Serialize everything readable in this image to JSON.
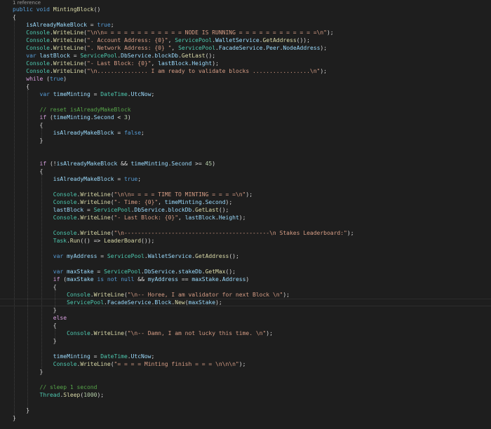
{
  "editor": {
    "codelens_text": "1 reference",
    "lines": [
      [
        [
          "kw",
          "public"
        ],
        [
          "pn",
          " "
        ],
        [
          "kw",
          "void"
        ],
        [
          "pn",
          " "
        ],
        [
          "fn",
          "MintingBlock"
        ],
        [
          "pn",
          "()"
        ]
      ],
      [
        [
          "pn",
          "{"
        ]
      ],
      [
        [
          "pn",
          "    "
        ],
        [
          "var",
          "isAlreadyMakeBlock"
        ],
        [
          "pn",
          " = "
        ],
        [
          "kw",
          "true"
        ],
        [
          "pn",
          ";"
        ]
      ],
      [
        [
          "pn",
          "    "
        ],
        [
          "ty",
          "Console"
        ],
        [
          "pn",
          "."
        ],
        [
          "fn",
          "WriteLine"
        ],
        [
          "pn",
          "("
        ],
        [
          "str",
          "\"\\n\\n= = = = = = = = = = = = NODE IS RUNNING = = = = = = = = = = = =\\n\""
        ],
        [
          "pn",
          ");"
        ]
      ],
      [
        [
          "pn",
          "    "
        ],
        [
          "ty",
          "Console"
        ],
        [
          "pn",
          "."
        ],
        [
          "fn",
          "WriteLine"
        ],
        [
          "pn",
          "("
        ],
        [
          "str",
          "\". Account Address: {0}\""
        ],
        [
          "pn",
          ", "
        ],
        [
          "ty",
          "ServicePool"
        ],
        [
          "pn",
          "."
        ],
        [
          "var",
          "WalletService"
        ],
        [
          "pn",
          "."
        ],
        [
          "fn",
          "GetAddress"
        ],
        [
          "pn",
          "());"
        ]
      ],
      [
        [
          "pn",
          "    "
        ],
        [
          "ty",
          "Console"
        ],
        [
          "pn",
          "."
        ],
        [
          "fn",
          "WriteLine"
        ],
        [
          "pn",
          "("
        ],
        [
          "str",
          "\". Network Address: {0} \""
        ],
        [
          "pn",
          ", "
        ],
        [
          "ty",
          "ServicePool"
        ],
        [
          "pn",
          "."
        ],
        [
          "var",
          "FacadeService"
        ],
        [
          "pn",
          "."
        ],
        [
          "var",
          "Peer"
        ],
        [
          "pn",
          "."
        ],
        [
          "var",
          "NodeAddress"
        ],
        [
          "pn",
          ");"
        ]
      ],
      [
        [
          "pn",
          "    "
        ],
        [
          "kw",
          "var"
        ],
        [
          "pn",
          " "
        ],
        [
          "var",
          "lastBlock"
        ],
        [
          "pn",
          " = "
        ],
        [
          "ty",
          "ServicePool"
        ],
        [
          "pn",
          "."
        ],
        [
          "var",
          "DbService"
        ],
        [
          "pn",
          "."
        ],
        [
          "var",
          "blockDb"
        ],
        [
          "pn",
          "."
        ],
        [
          "fn",
          "GetLast"
        ],
        [
          "pn",
          "();"
        ]
      ],
      [
        [
          "pn",
          "    "
        ],
        [
          "ty",
          "Console"
        ],
        [
          "pn",
          "."
        ],
        [
          "fn",
          "WriteLine"
        ],
        [
          "pn",
          "("
        ],
        [
          "str",
          "\"- Last Block: {0}\""
        ],
        [
          "pn",
          ", "
        ],
        [
          "var",
          "lastBlock"
        ],
        [
          "pn",
          "."
        ],
        [
          "var",
          "Height"
        ],
        [
          "pn",
          ");"
        ]
      ],
      [
        [
          "pn",
          "    "
        ],
        [
          "ty",
          "Console"
        ],
        [
          "pn",
          "."
        ],
        [
          "fn",
          "WriteLine"
        ],
        [
          "pn",
          "("
        ],
        [
          "str",
          "\"\\n............... I am ready to validate blocks .................\\n\""
        ],
        [
          "pn",
          ");"
        ]
      ],
      [
        [
          "pn",
          "    "
        ],
        [
          "ctl",
          "while"
        ],
        [
          "pn",
          " ("
        ],
        [
          "kw",
          "true"
        ],
        [
          "pn",
          ")"
        ]
      ],
      [
        [
          "pn",
          "    {"
        ]
      ],
      [
        [
          "pn",
          "        "
        ],
        [
          "kw",
          "var"
        ],
        [
          "pn",
          " "
        ],
        [
          "var",
          "timeMinting"
        ],
        [
          "pn",
          " = "
        ],
        [
          "ty",
          "DateTime"
        ],
        [
          "pn",
          "."
        ],
        [
          "var",
          "UtcNow"
        ],
        [
          "pn",
          ";"
        ]
      ],
      [
        [
          "pn",
          ""
        ]
      ],
      [
        [
          "pn",
          "        "
        ],
        [
          "cm",
          "// reset isAlreadyMakeBlock"
        ]
      ],
      [
        [
          "pn",
          "        "
        ],
        [
          "ctl",
          "if"
        ],
        [
          "pn",
          " ("
        ],
        [
          "var",
          "timeMinting"
        ],
        [
          "pn",
          "."
        ],
        [
          "var",
          "Second"
        ],
        [
          "pn",
          " < "
        ],
        [
          "num",
          "3"
        ],
        [
          "pn",
          ")"
        ]
      ],
      [
        [
          "pn",
          "        {"
        ]
      ],
      [
        [
          "pn",
          "            "
        ],
        [
          "var",
          "isAlreadyMakeBlock"
        ],
        [
          "pn",
          " = "
        ],
        [
          "kw",
          "false"
        ],
        [
          "pn",
          ";"
        ]
      ],
      [
        [
          "pn",
          "        }"
        ]
      ],
      [
        [
          "pn",
          ""
        ]
      ],
      [
        [
          "pn",
          ""
        ]
      ],
      [
        [
          "pn",
          "        "
        ],
        [
          "ctl",
          "if"
        ],
        [
          "pn",
          " (!"
        ],
        [
          "var",
          "isAlreadyMakeBlock"
        ],
        [
          "pn",
          " && "
        ],
        [
          "var",
          "timeMinting"
        ],
        [
          "pn",
          "."
        ],
        [
          "var",
          "Second"
        ],
        [
          "pn",
          " >= "
        ],
        [
          "num",
          "45"
        ],
        [
          "pn",
          ")"
        ]
      ],
      [
        [
          "pn",
          "        {"
        ]
      ],
      [
        [
          "pn",
          "            "
        ],
        [
          "var",
          "isAlreadyMakeBlock"
        ],
        [
          "pn",
          " = "
        ],
        [
          "kw",
          "true"
        ],
        [
          "pn",
          ";"
        ]
      ],
      [
        [
          "pn",
          ""
        ]
      ],
      [
        [
          "pn",
          "            "
        ],
        [
          "ty",
          "Console"
        ],
        [
          "pn",
          "."
        ],
        [
          "fn",
          "WriteLine"
        ],
        [
          "pn",
          "("
        ],
        [
          "str",
          "\"\\n\\n= = = = TIME TO MINTING = = = =\\n\""
        ],
        [
          "pn",
          ");"
        ]
      ],
      [
        [
          "pn",
          "            "
        ],
        [
          "ty",
          "Console"
        ],
        [
          "pn",
          "."
        ],
        [
          "fn",
          "WriteLine"
        ],
        [
          "pn",
          "("
        ],
        [
          "str",
          "\"- Time: {0}\""
        ],
        [
          "pn",
          ", "
        ],
        [
          "var",
          "timeMinting"
        ],
        [
          "pn",
          "."
        ],
        [
          "var",
          "Second"
        ],
        [
          "pn",
          ");"
        ]
      ],
      [
        [
          "pn",
          "            "
        ],
        [
          "var",
          "lastBlock"
        ],
        [
          "pn",
          " = "
        ],
        [
          "ty",
          "ServicePool"
        ],
        [
          "pn",
          "."
        ],
        [
          "var",
          "DbService"
        ],
        [
          "pn",
          "."
        ],
        [
          "var",
          "blockDb"
        ],
        [
          "pn",
          "."
        ],
        [
          "fn",
          "GetLast"
        ],
        [
          "pn",
          "();"
        ]
      ],
      [
        [
          "pn",
          "            "
        ],
        [
          "ty",
          "Console"
        ],
        [
          "pn",
          "."
        ],
        [
          "fn",
          "WriteLine"
        ],
        [
          "pn",
          "("
        ],
        [
          "str",
          "\"- Last Block: {0}\""
        ],
        [
          "pn",
          ", "
        ],
        [
          "var",
          "lastBlock"
        ],
        [
          "pn",
          "."
        ],
        [
          "var",
          "Height"
        ],
        [
          "pn",
          ");"
        ]
      ],
      [
        [
          "pn",
          ""
        ]
      ],
      [
        [
          "pn",
          "            "
        ],
        [
          "ty",
          "Console"
        ],
        [
          "pn",
          "."
        ],
        [
          "fn",
          "WriteLine"
        ],
        [
          "pn",
          "("
        ],
        [
          "str",
          "\"\\n-------------------------------------------\\n Stakes Leaderboard:\""
        ],
        [
          "pn",
          ");"
        ]
      ],
      [
        [
          "pn",
          "            "
        ],
        [
          "ty",
          "Task"
        ],
        [
          "pn",
          "."
        ],
        [
          "fn",
          "Run"
        ],
        [
          "pn",
          "(() => "
        ],
        [
          "fn",
          "LeaderBoard"
        ],
        [
          "pn",
          "());"
        ]
      ],
      [
        [
          "pn",
          ""
        ]
      ],
      [
        [
          "pn",
          "            "
        ],
        [
          "kw",
          "var"
        ],
        [
          "pn",
          " "
        ],
        [
          "var",
          "myAddress"
        ],
        [
          "pn",
          " = "
        ],
        [
          "ty",
          "ServicePool"
        ],
        [
          "pn",
          "."
        ],
        [
          "var",
          "WalletService"
        ],
        [
          "pn",
          "."
        ],
        [
          "fn",
          "GetAddress"
        ],
        [
          "pn",
          "();"
        ]
      ],
      [
        [
          "pn",
          ""
        ]
      ],
      [
        [
          "pn",
          "            "
        ],
        [
          "kw",
          "var"
        ],
        [
          "pn",
          " "
        ],
        [
          "var",
          "maxStake"
        ],
        [
          "pn",
          " = "
        ],
        [
          "ty",
          "ServicePool"
        ],
        [
          "pn",
          "."
        ],
        [
          "var",
          "DbService"
        ],
        [
          "pn",
          "."
        ],
        [
          "var",
          "stakeDb"
        ],
        [
          "pn",
          "."
        ],
        [
          "fn",
          "GetMax"
        ],
        [
          "pn",
          "();"
        ]
      ],
      [
        [
          "pn",
          "            "
        ],
        [
          "ctl",
          "if"
        ],
        [
          "pn",
          " ("
        ],
        [
          "var",
          "maxStake"
        ],
        [
          "pn",
          " "
        ],
        [
          "kw",
          "is"
        ],
        [
          "pn",
          " "
        ],
        [
          "kw",
          "not"
        ],
        [
          "pn",
          " "
        ],
        [
          "kw",
          "null"
        ],
        [
          "pn",
          " && "
        ],
        [
          "var",
          "myAddress"
        ],
        [
          "pn",
          " == "
        ],
        [
          "var",
          "maxStake"
        ],
        [
          "pn",
          "."
        ],
        [
          "var",
          "Address"
        ],
        [
          "pn",
          ")"
        ]
      ],
      [
        [
          "pn",
          "            {"
        ]
      ],
      [
        [
          "pn",
          "                "
        ],
        [
          "ty",
          "Console"
        ],
        [
          "pn",
          "."
        ],
        [
          "fn",
          "WriteLine"
        ],
        [
          "pn",
          "("
        ],
        [
          "str",
          "\"\\n-- Horee, I am validator for next Block \\n\""
        ],
        [
          "pn",
          ");"
        ]
      ],
      [
        [
          "pn",
          "                "
        ],
        [
          "ty",
          "ServicePool"
        ],
        [
          "pn",
          "."
        ],
        [
          "var",
          "FacadeService"
        ],
        [
          "pn",
          "."
        ],
        [
          "var",
          "Block"
        ],
        [
          "pn",
          "."
        ],
        [
          "fn",
          "New"
        ],
        [
          "pn",
          "("
        ],
        [
          "var",
          "maxStake"
        ],
        [
          "pn",
          ");"
        ]
      ],
      [
        [
          "pn",
          "            }"
        ]
      ],
      [
        [
          "pn",
          "            "
        ],
        [
          "ctl",
          "else"
        ]
      ],
      [
        [
          "pn",
          "            {"
        ]
      ],
      [
        [
          "pn",
          "                "
        ],
        [
          "ty",
          "Console"
        ],
        [
          "pn",
          "."
        ],
        [
          "fn",
          "WriteLine"
        ],
        [
          "pn",
          "("
        ],
        [
          "str",
          "\"\\n-- Damn, I am not lucky this time. \\n\""
        ],
        [
          "pn",
          ");"
        ]
      ],
      [
        [
          "pn",
          "            }"
        ]
      ],
      [
        [
          "pn",
          ""
        ]
      ],
      [
        [
          "pn",
          "            "
        ],
        [
          "var",
          "timeMinting"
        ],
        [
          "pn",
          " = "
        ],
        [
          "ty",
          "DateTime"
        ],
        [
          "pn",
          "."
        ],
        [
          "var",
          "UtcNow"
        ],
        [
          "pn",
          ";"
        ]
      ],
      [
        [
          "pn",
          "            "
        ],
        [
          "ty",
          "Console"
        ],
        [
          "pn",
          "."
        ],
        [
          "fn",
          "WriteLine"
        ],
        [
          "pn",
          "("
        ],
        [
          "str",
          "\"= = = = Minting finish = = = \\n\\n\\n\""
        ],
        [
          "pn",
          ");"
        ]
      ],
      [
        [
          "pn",
          "        }"
        ]
      ],
      [
        [
          "pn",
          ""
        ]
      ],
      [
        [
          "pn",
          "        "
        ],
        [
          "cm",
          "// sleep 1 second"
        ]
      ],
      [
        [
          "pn",
          "        "
        ],
        [
          "ty",
          "Thread"
        ],
        [
          "pn",
          "."
        ],
        [
          "fn",
          "Sleep"
        ],
        [
          "pn",
          "("
        ],
        [
          "num",
          "1000"
        ],
        [
          "pn",
          ");"
        ]
      ],
      [
        [
          "pn",
          ""
        ]
      ],
      [
        [
          "pn",
          "    }"
        ]
      ],
      [
        [
          "pn",
          "}"
        ]
      ]
    ]
  }
}
